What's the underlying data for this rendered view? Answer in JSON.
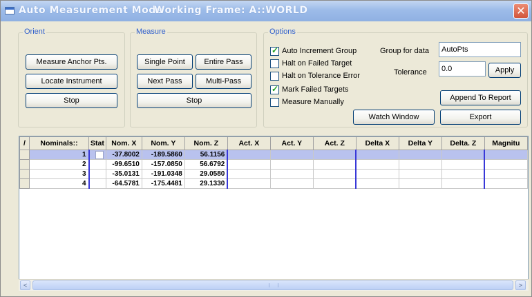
{
  "window": {
    "title": "Auto Measurement Mode",
    "working_frame": "Working Frame:  A::WORLD",
    "close_glyph": "✕"
  },
  "orient": {
    "label": "Orient",
    "measure_anchor": "Measure Anchor Pts.",
    "locate_instrument": "Locate Instrument",
    "stop": "Stop"
  },
  "measure": {
    "label": "Measure",
    "single_point": "Single Point",
    "entire_pass": "Entire Pass",
    "next_pass": "Next Pass",
    "multi_pass": "Multi-Pass",
    "stop": "Stop"
  },
  "options": {
    "label": "Options",
    "auto_increment": {
      "label": "Auto Increment Group",
      "checked": true
    },
    "halt_failed": {
      "label": "Halt on Failed Target",
      "checked": false
    },
    "halt_tolerance": {
      "label": "Halt on Tolerance Error",
      "checked": false
    },
    "mark_failed": {
      "label": "Mark Failed Targets",
      "checked": true
    },
    "measure_manually": {
      "label": "Measure Manually",
      "checked": false
    },
    "group_for_data_label": "Group for data",
    "group_for_data_value": "AutoPts",
    "tolerance_label": "Tolerance",
    "tolerance_value": "0.0",
    "apply": "Apply",
    "append_to_report": "Append To Report",
    "watch_window": "Watch Window",
    "export": "Export"
  },
  "grid": {
    "corner": "/",
    "columns": [
      "Nominals::",
      "Stat",
      "Nom. X",
      "Nom. Y",
      "Nom. Z",
      "Act. X",
      "Act. Y",
      "Act. Z",
      "Delta X",
      "Delta Y",
      "Delta. Z",
      "Magnitu"
    ],
    "rows": [
      {
        "nominal": "1",
        "nom_x": "-37.8002",
        "nom_y": "-189.5860",
        "nom_z": "56.1156"
      },
      {
        "nominal": "2",
        "nom_x": "-99.6510",
        "nom_y": "-157.0850",
        "nom_z": "56.6792"
      },
      {
        "nominal": "3",
        "nom_x": "-35.0131",
        "nom_y": "-191.0348",
        "nom_z": "29.0580"
      },
      {
        "nominal": "4",
        "nom_x": "-64.5781",
        "nom_y": "-175.4481",
        "nom_z": "29.1330"
      }
    ],
    "selected_row": 0
  },
  "scrollbar": {
    "left": "<",
    "right": ">"
  },
  "colors": {
    "selection": "#b9c2ee",
    "group_label": "#2f5fcc",
    "separator": "#3838d8"
  }
}
